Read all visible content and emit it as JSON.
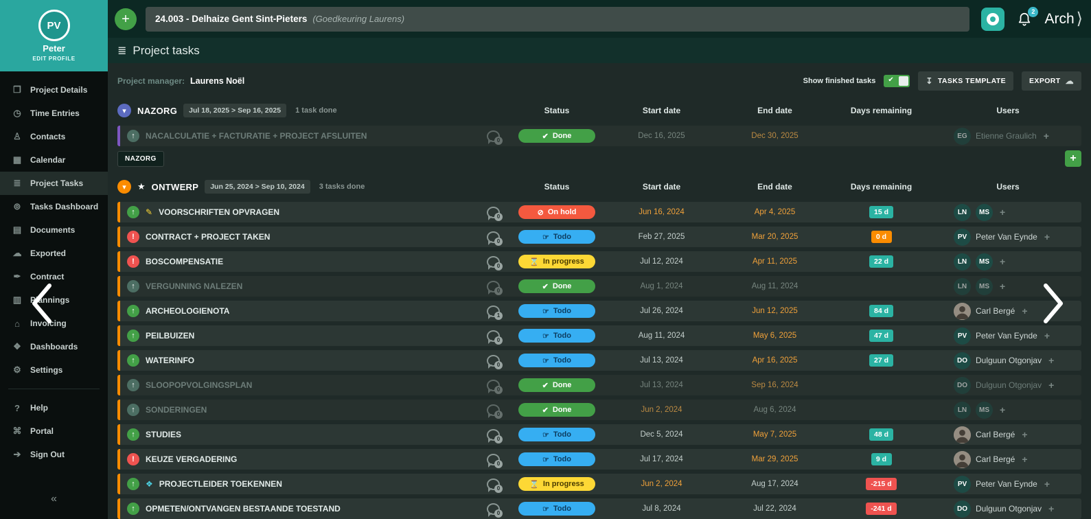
{
  "topbar": {
    "add_glyph": "+",
    "project_title": "24.003 - Delhaize Gent Sint-Pieters",
    "project_note": "(Goedkeuring Laurens)",
    "notification_count": "2",
    "brand": "Arch",
    "brand_chevron": "⟩"
  },
  "header": {
    "title": "Project tasks",
    "icon_glyph": "≣"
  },
  "sidebar": {
    "initials": "PV",
    "name": "Peter",
    "edit_profile": "EDIT PROFILE",
    "collapse": "«",
    "items": [
      {
        "label": "Project Details",
        "icon": "project-details-icon",
        "glyph": "❒",
        "active": false
      },
      {
        "label": "Time Entries",
        "icon": "clock-icon",
        "glyph": "◷",
        "active": false
      },
      {
        "label": "Contacts",
        "icon": "contacts-icon",
        "glyph": "♙",
        "active": false
      },
      {
        "label": "Calendar",
        "icon": "calendar-icon",
        "glyph": "▦",
        "active": false
      },
      {
        "label": "Project Tasks",
        "icon": "tasks-list-icon",
        "glyph": "≣",
        "active": true
      },
      {
        "label": "Tasks Dashboard",
        "icon": "gauge-icon",
        "glyph": "⊚",
        "active": false
      },
      {
        "label": "Documents",
        "icon": "documents-icon",
        "glyph": "▤",
        "active": false
      },
      {
        "label": "Exported",
        "icon": "cloud-icon",
        "glyph": "☁",
        "active": false
      },
      {
        "label": "Contract",
        "icon": "contract-icon",
        "glyph": "✒",
        "active": false
      },
      {
        "label": "Plannings",
        "icon": "plannings-icon",
        "glyph": "▥",
        "active": false
      },
      {
        "label": "Invoicing",
        "icon": "bank-icon",
        "glyph": "⌂",
        "active": false
      },
      {
        "label": "Dashboards",
        "icon": "dashboards-icon",
        "glyph": "❖",
        "active": false
      },
      {
        "label": "Settings",
        "icon": "gear-icon",
        "glyph": "⚙",
        "active": false
      }
    ],
    "footer_items": [
      {
        "label": "Help",
        "icon": "help-icon",
        "glyph": "?"
      },
      {
        "label": "Portal",
        "icon": "portal-icon",
        "glyph": "⌘"
      },
      {
        "label": "Sign Out",
        "icon": "sign-out-icon",
        "glyph": "➔"
      }
    ]
  },
  "toolbar": {
    "project_manager_label": "Project manager:",
    "project_manager_name": "Laurens Noël",
    "show_finished_label": "Show finished tasks",
    "tasks_template_label": "TASKS TEMPLATE",
    "template_icon_glyph": "↧",
    "export_label": "EXPORT",
    "export_icon_glyph": "☁"
  },
  "columns": [
    "Status",
    "Start date",
    "End date",
    "Days remaining",
    "Users"
  ],
  "status_glyphs": {
    "Done": "✔",
    "Todo": "☞",
    "In progress": "⌛",
    "On hold": "⊘"
  },
  "days_colors": {
    "teal": "#2bb3a3",
    "orange": "#fb8c00",
    "red": "#ef5350"
  },
  "sections": [
    {
      "name": "NAZORG",
      "starred": false,
      "accent": "#7e57c2",
      "chevron_color": "#5c6bc0",
      "date_range": "Jul 18, 2025 > Sep 16, 2025",
      "done_label": "1 task done",
      "tag": "NAZORG",
      "tasks": [
        {
          "title": "NACALCULATIE + FACTURATIE + PROJECT AFSLUITEN",
          "done": true,
          "priority": "up",
          "comments": "0",
          "status": "Done",
          "start": "Dec 16, 2025",
          "start_overdue": false,
          "end": "Dec 30, 2025",
          "end_overdue": true,
          "days": "",
          "days_color": "",
          "users": [
            {
              "kind": "initials",
              "initials": "EG",
              "name": "Etienne Graulich"
            }
          ]
        }
      ]
    },
    {
      "name": "ONTWERP",
      "starred": true,
      "accent": "#fb8c00",
      "chevron_color": "#fb8c00",
      "date_range": "Jun 25, 2024 > Sep 10, 2024",
      "done_label": "3 tasks done",
      "tag": "",
      "tasks": [
        {
          "title": "VOORSCHRIFTEN OPVRAGEN",
          "done": false,
          "priority": "up",
          "extra": {
            "name": "pencil-icon",
            "glyph": "✎",
            "color": "#fdd835"
          },
          "comments": "0",
          "status": "On hold",
          "start": "Jun 16, 2024",
          "start_overdue": true,
          "end": "Apr 4, 2025",
          "end_overdue": true,
          "days": "15 d",
          "days_color": "teal",
          "users": [
            {
              "kind": "initials",
              "initials": "LN"
            },
            {
              "kind": "initials",
              "initials": "MS"
            }
          ]
        },
        {
          "title": "CONTRACT + PROJECT TAKEN",
          "done": false,
          "priority": "alert",
          "comments": "0",
          "status": "Todo",
          "start": "Feb 27, 2025",
          "start_overdue": false,
          "end": "Mar 20, 2025",
          "end_overdue": true,
          "days": "0 d",
          "days_color": "orange",
          "users": [
            {
              "kind": "initials",
              "initials": "PV",
              "name": "Peter Van Eynde"
            }
          ]
        },
        {
          "title": "BOSCOMPENSATIE",
          "done": false,
          "priority": "alert",
          "comments": "0",
          "status": "In progress",
          "start": "Jul 12, 2024",
          "start_overdue": false,
          "end": "Apr 11, 2025",
          "end_overdue": true,
          "days": "22 d",
          "days_color": "teal",
          "users": [
            {
              "kind": "initials",
              "initials": "LN"
            },
            {
              "kind": "initials",
              "initials": "MS"
            }
          ]
        },
        {
          "title": "VERGUNNING NALEZEN",
          "done": true,
          "priority": "up",
          "comments": "0",
          "status": "Done",
          "start": "Aug 1, 2024",
          "start_overdue": false,
          "end": "Aug 11, 2024",
          "end_overdue": false,
          "days": "",
          "days_color": "",
          "users": [
            {
              "kind": "initials",
              "initials": "LN"
            },
            {
              "kind": "initials",
              "initials": "MS"
            }
          ]
        },
        {
          "title": "ARCHEOLOGIENOTA",
          "done": false,
          "priority": "up",
          "comments": "1",
          "status": "Todo",
          "start": "Jul 26, 2024",
          "start_overdue": false,
          "end": "Jun 12, 2025",
          "end_overdue": true,
          "days": "84 d",
          "days_color": "teal",
          "users": [
            {
              "kind": "photo",
              "name": "Carl Bergé"
            }
          ]
        },
        {
          "title": "PEILBUIZEN",
          "done": false,
          "priority": "up",
          "comments": "0",
          "status": "Todo",
          "start": "Aug 11, 2024",
          "start_overdue": false,
          "end": "May 6, 2025",
          "end_overdue": true,
          "days": "47 d",
          "days_color": "teal",
          "users": [
            {
              "kind": "initials",
              "initials": "PV",
              "name": "Peter Van Eynde"
            }
          ]
        },
        {
          "title": "WATERINFO",
          "done": false,
          "priority": "up",
          "comments": "0",
          "status": "Todo",
          "start": "Jul 13, 2024",
          "start_overdue": false,
          "end": "Apr 16, 2025",
          "end_overdue": true,
          "days": "27 d",
          "days_color": "teal",
          "users": [
            {
              "kind": "initials",
              "initials": "DO",
              "name": "Dulguun Otgonjav"
            }
          ]
        },
        {
          "title": "SLOOPOPVOLGINGSPLAN",
          "done": true,
          "priority": "up",
          "comments": "0",
          "status": "Done",
          "start": "Jul 13, 2024",
          "start_overdue": false,
          "end": "Sep 16, 2024",
          "end_overdue": true,
          "days": "",
          "days_color": "",
          "users": [
            {
              "kind": "initials",
              "initials": "DO",
              "name": "Dulguun Otgonjav"
            }
          ]
        },
        {
          "title": "SONDERINGEN",
          "done": true,
          "priority": "up",
          "comments": "0",
          "status": "Done",
          "start": "Jun 2, 2024",
          "start_overdue": true,
          "end": "Aug 6, 2024",
          "end_overdue": false,
          "days": "",
          "days_color": "",
          "users": [
            {
              "kind": "initials",
              "initials": "LN"
            },
            {
              "kind": "initials",
              "initials": "MS"
            }
          ]
        },
        {
          "title": "STUDIES",
          "done": false,
          "priority": "up",
          "comments": "0",
          "status": "Todo",
          "start": "Dec 5, 2024",
          "start_overdue": false,
          "end": "May 7, 2025",
          "end_overdue": true,
          "days": "48 d",
          "days_color": "teal",
          "users": [
            {
              "kind": "photo",
              "name": "Carl Bergé"
            }
          ]
        },
        {
          "title": "KEUZE VERGADERING",
          "done": false,
          "priority": "alert",
          "comments": "0",
          "status": "Todo",
          "start": "Jul 17, 2024",
          "start_overdue": false,
          "end": "Mar 29, 2025",
          "end_overdue": true,
          "days": "9 d",
          "days_color": "teal",
          "users": [
            {
              "kind": "photo",
              "name": "Carl Bergé"
            }
          ]
        },
        {
          "title": "PROJECTLEIDER TOEKENNEN",
          "done": false,
          "priority": "up",
          "extra": {
            "name": "badge-icon",
            "glyph": "❖",
            "color": "#4dd0e1"
          },
          "comments": "0",
          "status": "In progress",
          "start": "Jun 2, 2024",
          "start_overdue": true,
          "end": "Aug 17, 2024",
          "end_overdue": false,
          "days": "-215 d",
          "days_color": "red",
          "users": [
            {
              "kind": "initials",
              "initials": "PV",
              "name": "Peter Van Eynde"
            }
          ]
        },
        {
          "title": "OPMETEN/ONTVANGEN BESTAANDE TOESTAND",
          "done": false,
          "priority": "up",
          "comments": "0",
          "status": "Todo",
          "start": "Jul 8, 2024",
          "start_overdue": false,
          "end": "Jul 22, 2024",
          "end_overdue": false,
          "days": "-241 d",
          "days_color": "red",
          "users": [
            {
              "kind": "initials",
              "initials": "DO",
              "name": "Dulguun Otgonjav"
            }
          ]
        }
      ]
    }
  ]
}
